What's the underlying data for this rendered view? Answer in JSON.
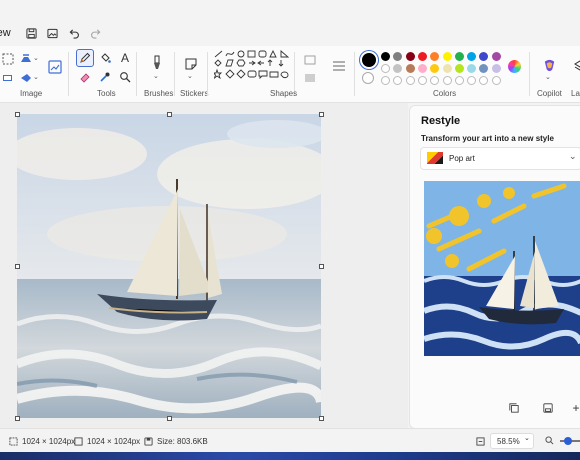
{
  "app": {
    "file_menu_label": "View"
  },
  "ribbon": {
    "groups": {
      "image": "Image",
      "tools": "Tools",
      "brushes": "Brushes",
      "stickers": "Stickers",
      "shapes": "Shapes",
      "colors": "Colors",
      "copilot": "Copilot",
      "layers": "Layers"
    },
    "text_tool_glyph": "A",
    "colors": {
      "primary": "#000000",
      "secondary": "#ffffff",
      "row1": [
        "#000000",
        "#7f7f7f",
        "#880015",
        "#ed1c24",
        "#ff7f27",
        "#fff200",
        "#22b14c",
        "#00a2e8",
        "#3f48cc",
        "#a349a4"
      ],
      "row2": [
        "#ffffff",
        "#c3c3c3",
        "#b97a57",
        "#ffaec9",
        "#ffc90e",
        "#efe4b0",
        "#b5e61d",
        "#99d9ea",
        "#7092be",
        "#c8bfe7"
      ],
      "empty_swatches": 10
    }
  },
  "restyle": {
    "title": "Restyle",
    "subtitle": "Transform your art into a new style",
    "style_selected": "Pop art"
  },
  "status": {
    "cursor_size": "1024 × 1024px",
    "selection_size": "1024 × 1024px",
    "file_size": "Size: 803.6KB",
    "zoom": "58.5%"
  }
}
